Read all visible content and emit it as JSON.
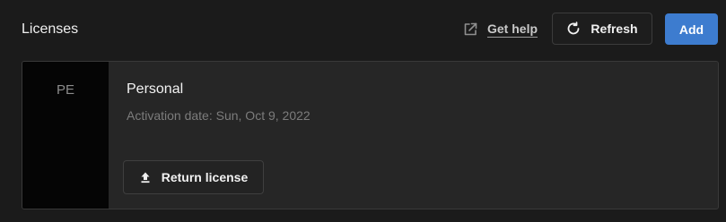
{
  "header": {
    "title": "Licenses",
    "get_help_label": "Get help",
    "refresh_label": "Refresh",
    "add_label": "Add"
  },
  "license": {
    "abbreviation": "PE",
    "name": "Personal",
    "activation_date": "Activation date: Sun, Oct 9, 2022",
    "return_label": "Return license"
  },
  "icons": {
    "get_help": "external-link-icon",
    "refresh": "refresh-icon",
    "return": "upload-arrow-icon"
  },
  "colors": {
    "background": "#1b1b1b",
    "card": "#262626",
    "badge": "#050505",
    "accent": "#3d7ccf"
  }
}
